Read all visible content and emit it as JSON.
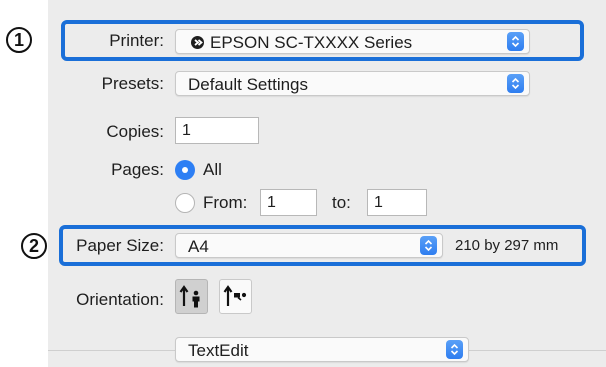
{
  "callouts": [
    "1",
    "2"
  ],
  "printer": {
    "label": "Printer:",
    "value": "EPSON SC-TXXXX Series"
  },
  "presets": {
    "label": "Presets:",
    "value": "Default Settings"
  },
  "copies": {
    "label": "Copies:",
    "value": "1"
  },
  "pages": {
    "label": "Pages:",
    "all_label": "All",
    "from_label": "From:",
    "from_value": "1",
    "to_label": "to:",
    "to_value": "1",
    "selected": "All"
  },
  "paper_size": {
    "label": "Paper Size:",
    "value": "A4",
    "dimensions": "210 by 297 mm"
  },
  "orientation": {
    "label": "Orientation:",
    "options": [
      "portrait",
      "landscape"
    ],
    "selected": "portrait"
  },
  "app_menu": {
    "value": "TextEdit"
  },
  "colors": {
    "accent": "#2d7ff4",
    "highlight": "#1a6fd8",
    "panel": "#ececec"
  }
}
